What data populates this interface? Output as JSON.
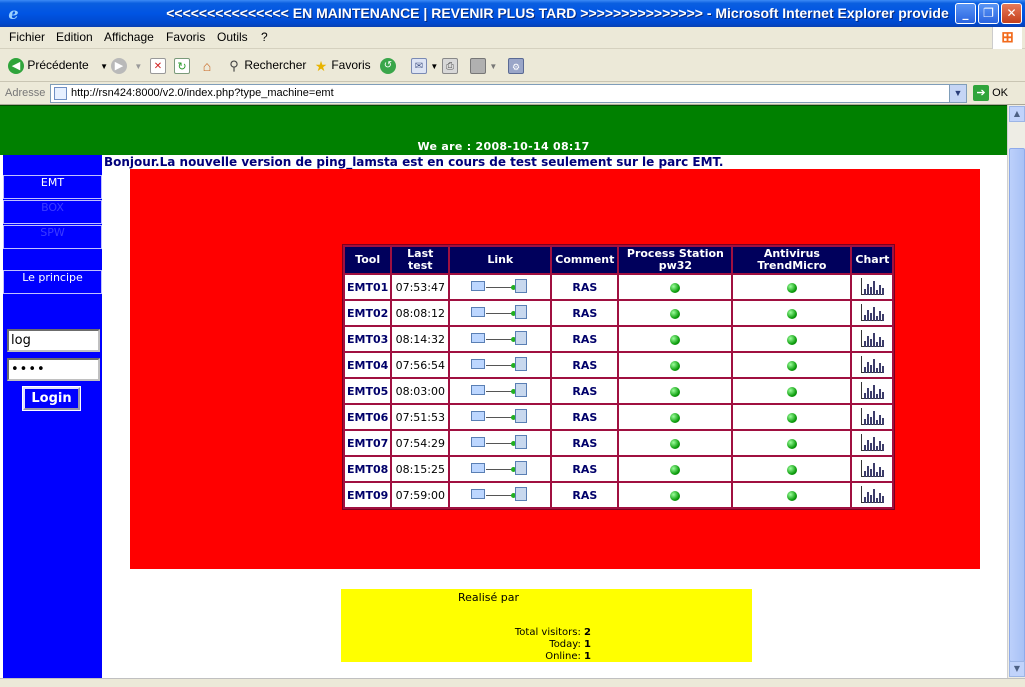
{
  "window": {
    "title": "<<<<<<<<<<<<<<< EN MAINTENANCE | REVENIR PLUS TARD >>>>>>>>>>>>>>> - Microsoft Internet Explorer provide"
  },
  "menu": [
    "Fichier",
    "Edition",
    "Affichage",
    "Favoris",
    "Outils",
    "?"
  ],
  "toolbar": {
    "back_label": "Précédente",
    "search_label": "Rechercher",
    "favorites_label": "Favoris"
  },
  "address": {
    "label": "Adresse",
    "url": "http://rsn424:8000/v2.0/index.php?type_machine=emt",
    "go_label": "OK"
  },
  "header": {
    "date_text": "We are : 2008-10-14 08:17"
  },
  "sidebar": {
    "items": [
      "EMT",
      "BOX",
      "SPW"
    ],
    "principle": "Le principe",
    "login_value": "log",
    "password_value": "••••",
    "login_button": "Login"
  },
  "welcome": "Bonjour.La nouvelle version de ping_lamsta est en cours de test seulement sur le parc EMT.",
  "monitor": {
    "columns": [
      "Tool",
      "Last test",
      "Link",
      "Comment",
      "Process Station pw32",
      "Antivirus TrendMicro",
      "Chart"
    ],
    "rows": [
      {
        "tool": "EMT01",
        "last_test": "07:53:47",
        "comment": "RAS",
        "process_status": "ok",
        "antivirus_status": "ok"
      },
      {
        "tool": "EMT02",
        "last_test": "08:08:12",
        "comment": "RAS",
        "process_status": "ok",
        "antivirus_status": "ok"
      },
      {
        "tool": "EMT03",
        "last_test": "08:14:32",
        "comment": "RAS",
        "process_status": "ok",
        "antivirus_status": "ok"
      },
      {
        "tool": "EMT04",
        "last_test": "07:56:54",
        "comment": "RAS",
        "process_status": "ok",
        "antivirus_status": "ok"
      },
      {
        "tool": "EMT05",
        "last_test": "08:03:00",
        "comment": "RAS",
        "process_status": "ok",
        "antivirus_status": "ok"
      },
      {
        "tool": "EMT06",
        "last_test": "07:51:53",
        "comment": "RAS",
        "process_status": "ok",
        "antivirus_status": "ok"
      },
      {
        "tool": "EMT07",
        "last_test": "07:54:29",
        "comment": "RAS",
        "process_status": "ok",
        "antivirus_status": "ok"
      },
      {
        "tool": "EMT08",
        "last_test": "08:15:25",
        "comment": "RAS",
        "process_status": "ok",
        "antivirus_status": "ok"
      },
      {
        "tool": "EMT09",
        "last_test": "07:59:00",
        "comment": "RAS",
        "process_status": "ok",
        "antivirus_status": "ok"
      }
    ]
  },
  "footer": {
    "credit": "Realisé par",
    "total_visitors_label": "Total visitors:",
    "total_visitors": "2",
    "today_label": "Today:",
    "today": "1",
    "online_label": "Online:",
    "online": "1"
  },
  "colors": {
    "header_green": "#008000",
    "sidebar_blue": "#0000ff",
    "content_red": "#ff0000",
    "footer_yellow": "#ffff00",
    "table_header": "#00005c"
  },
  "icons": {
    "link": "network-link-icon",
    "status": "green-status-dot-icon",
    "chart": "bar-chart-icon"
  }
}
